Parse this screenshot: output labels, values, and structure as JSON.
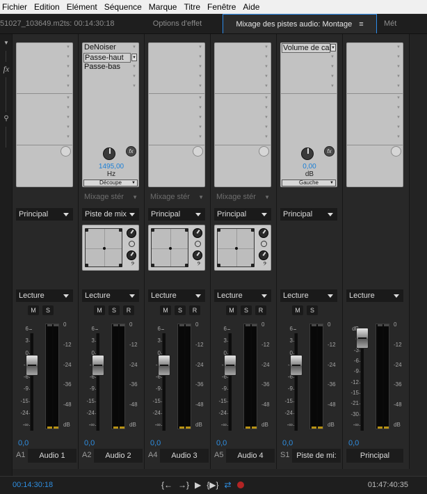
{
  "menu": [
    "Fichier",
    "Edition",
    "Elément",
    "Séquence",
    "Marque",
    "Titre",
    "Fenêtre",
    "Aide"
  ],
  "tabs": [
    {
      "label": "51027_103649.m2ts: 00:14:30:18",
      "active": false
    },
    {
      "label": "Options d'effet",
      "active": false
    },
    {
      "label": "Mixage des pistes audio: Montage",
      "active": true
    },
    {
      "label": "Mét",
      "active": false
    }
  ],
  "tab_menu_glyph": "≡",
  "left_icons": [
    "▼",
    "fx",
    "⚲"
  ],
  "strips": [
    {
      "effects": [
        "DeNoiser",
        "Passe-haut",
        "Passe-bas"
      ],
      "selected": 1,
      "knob": {
        "value": "1495,00",
        "unit": "Hz",
        "mode": "Découpe"
      },
      "stereo": "Mixage stér",
      "output": "Principal",
      "playback": "Lecture",
      "buttons": [
        "M",
        "S",
        "R"
      ],
      "volume": "0,0",
      "channel": "A2",
      "name": "Audio 2",
      "scale": [
        "6",
        "3",
        "0",
        "-3",
        "-6",
        "-9",
        "-15",
        "-24",
        "-∞"
      ],
      "meter_scale": [
        "0",
        "-12",
        "-24",
        "-36",
        "-48",
        "dB"
      ],
      "fader_level": 0.28,
      "pan": true
    },
    {
      "effects": [],
      "stereo": "Mixage stér",
      "output": "Principal",
      "playback": "Lecture",
      "buttons": [
        "M",
        "S",
        "R"
      ],
      "volume": "0,0",
      "channel": "A4",
      "name": "Audio 3",
      "scale": [
        "6",
        "3",
        "0",
        "-3",
        "-6",
        "-9",
        "-15",
        "-24",
        "-∞"
      ],
      "meter_scale": [
        "0",
        "-12",
        "-24",
        "-36",
        "-48",
        "dB"
      ],
      "fader_level": 0.28,
      "pan": true
    },
    {
      "effects": [],
      "stereo": "Mixage stér",
      "output": "Principal",
      "playback": "Lecture",
      "buttons": [
        "M",
        "S",
        "R"
      ],
      "volume": "0,0",
      "channel": "A5",
      "name": "Audio 4",
      "scale": [
        "6",
        "3",
        "0",
        "-3",
        "-6",
        "-9",
        "-15",
        "-24",
        "-∞"
      ],
      "meter_scale": [
        "0",
        "-12",
        "-24",
        "-36",
        "-48",
        "dB"
      ],
      "fader_level": 0.28,
      "pan": true
    }
  ],
  "strip1": {
    "output": "Principal",
    "playback": "Lecture",
    "buttons": [
      "M",
      "S"
    ],
    "volume": "0,0",
    "channel": "A1",
    "name": "Audio 1",
    "scale": [
      "6",
      "3",
      "0",
      "-3",
      "-6",
      "-9",
      "-15",
      "-24",
      "-∞"
    ],
    "meter_scale": [
      "0",
      "-12",
      "-24",
      "-36",
      "-48",
      "dB"
    ]
  },
  "strip2": {
    "pan_output": "Piste de mix"
  },
  "submix": {
    "effects": [
      "Volume de ca"
    ],
    "knob": {
      "value": "0,00",
      "unit": "dB",
      "mode": "Gauche"
    },
    "output": "Principal",
    "playback": "Lecture",
    "buttons": [
      "M",
      "S"
    ],
    "volume": "0,0",
    "channel": "S1",
    "name": "Piste de mi:",
    "scale": [
      "6",
      "3",
      "0",
      "-3",
      "-6",
      "-9",
      "-15",
      "-24",
      "-∞"
    ],
    "meter_scale": [
      "0",
      "-12",
      "-24",
      "-36",
      "-48",
      "dB"
    ]
  },
  "master": {
    "playback": "Lecture",
    "volume": "0,0",
    "name": "Principal",
    "scale": [
      "dB",
      "0",
      "-3",
      "-6",
      "-9",
      "-12",
      "-15",
      "-21",
      "-30",
      "-∞"
    ],
    "meter_scale": [
      "0",
      "-12",
      "-24",
      "-36",
      "-48",
      "dB"
    ]
  },
  "bottom": {
    "timecode_left": "00:14:30:18",
    "timecode_right": "01:47:40:35",
    "transport": [
      "{←",
      "→}",
      "▶",
      "{▶}",
      "⇄",
      "●"
    ]
  },
  "colors": {
    "accent": "#2f8ee0",
    "record": "#b22424"
  }
}
